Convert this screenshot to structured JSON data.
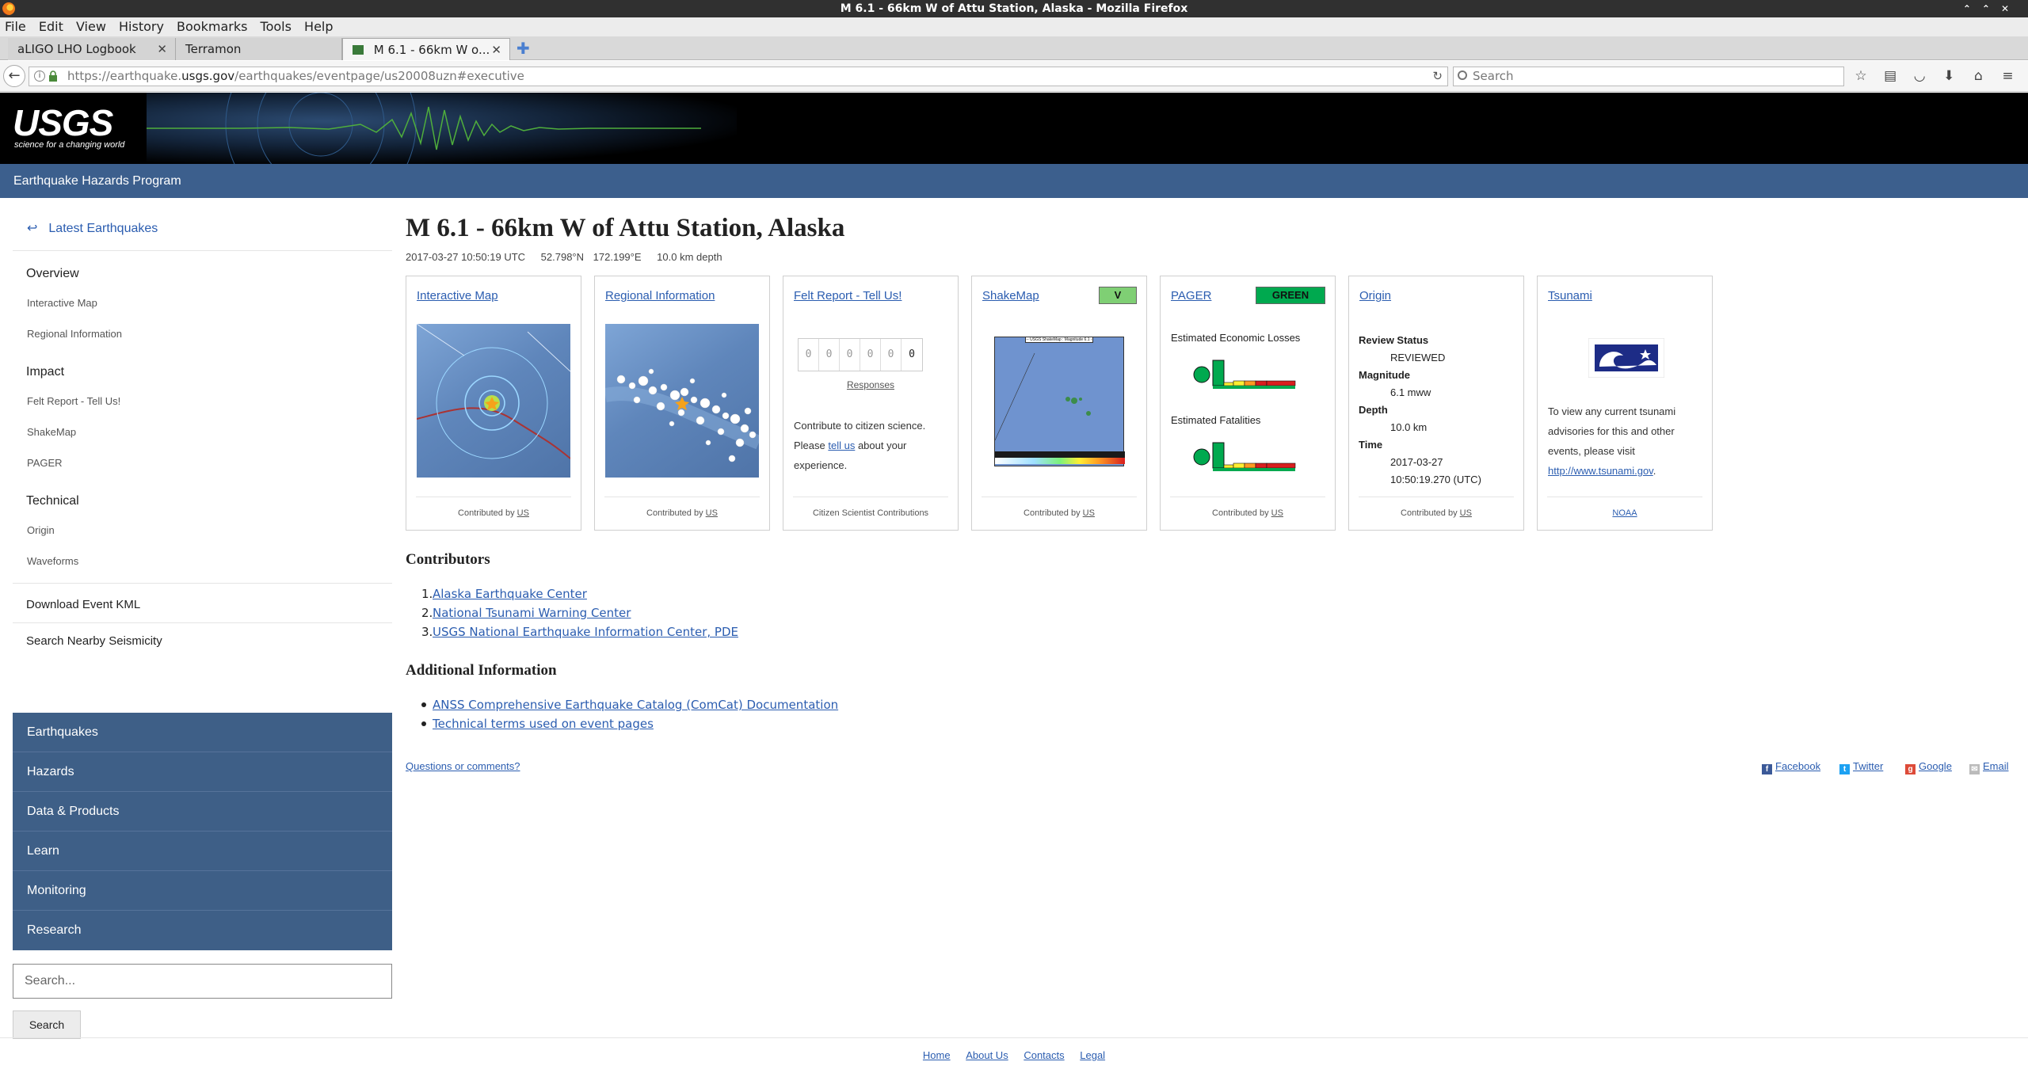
{
  "window": {
    "title": "M 6.1 - 66km W of Attu Station, Alaska - Mozilla Firefox"
  },
  "menu": [
    "File",
    "Edit",
    "View",
    "History",
    "Bookmarks",
    "Tools",
    "Help"
  ],
  "tabs": [
    {
      "label": "aLIGO LHO Logbook"
    },
    {
      "label": "Terramon"
    },
    {
      "label": "M 6.1 - 66km W o..."
    }
  ],
  "nav": {
    "url_prefix": "https://earthquake.",
    "url_domain": "usgs.gov",
    "url_path": "/earthquakes/eventpage/us20008uzn#executive",
    "search_placeholder": "Search"
  },
  "header": {
    "logo_text": "USGS",
    "logo_tagline": "science for a changing world",
    "program": "Earthquake Hazards Program"
  },
  "sidebar": {
    "back": "Latest Earthquakes",
    "sections": [
      {
        "heading": "Overview",
        "items": [
          "Interactive Map",
          "Regional Information"
        ]
      },
      {
        "heading": "Impact",
        "items": [
          "Felt Report - Tell Us!",
          "ShakeMap",
          "PAGER"
        ]
      },
      {
        "heading": "Technical",
        "items": [
          "Origin",
          "Waveforms"
        ]
      }
    ],
    "links": [
      "Download Event KML",
      "Search Nearby Seismicity"
    ],
    "nav": [
      "Earthquakes",
      "Hazards",
      "Data & Products",
      "Learn",
      "Monitoring",
      "Research"
    ],
    "search_placeholder": "Search...",
    "search_button": "Search"
  },
  "event": {
    "title": "M 6.1 - 66km W of Attu Station, Alaska",
    "time": "2017-03-27 10:50:19 UTC",
    "lat": "52.798°N",
    "lon": "172.199°E",
    "depth": "10.0 km depth"
  },
  "cards": {
    "interactive_map": {
      "title": "Interactive Map",
      "foot": "Contributed by",
      "source": "US"
    },
    "regional": {
      "title": "Regional Information",
      "foot": "Contributed by",
      "source": "US"
    },
    "felt": {
      "title": "Felt Report - Tell Us!",
      "digits": [
        "0",
        "0",
        "0",
        "0",
        "0",
        "0"
      ],
      "responses": "Responses",
      "text_a": "Contribute to citizen science. Please ",
      "link": "tell us",
      "text_b": " about your experience.",
      "foot": "Citizen Scientist Contributions"
    },
    "shakemap": {
      "title": "ShakeMap",
      "badge": "V",
      "foot": "Contributed by",
      "source": "US",
      "map_title": "-- USGS ShakeMap : Magnitude 6.1 --"
    },
    "pager": {
      "title": "PAGER",
      "badge": "GREEN",
      "losses": "Estimated Economic Losses",
      "fatalities": "Estimated Fatalities",
      "foot": "Contributed by",
      "source": "US"
    },
    "origin": {
      "title": "Origin",
      "review_label": "Review Status",
      "review": "REVIEWED",
      "mag_label": "Magnitude",
      "mag": "6.1 mww",
      "depth_label": "Depth",
      "depth": "10.0 km",
      "time_label": "Time",
      "date": "2017-03-27",
      "time": "10:50:19.270 (UTC)",
      "foot": "Contributed by",
      "source": "US"
    },
    "tsunami": {
      "title": "Tsunami",
      "text": "To view any current tsunami advisories for this and other events, please visit ",
      "link": "http://www.tsunami.gov",
      "end": ".",
      "foot": "NOAA"
    }
  },
  "contributors": {
    "heading": "Contributors",
    "items": [
      "Alaska Earthquake Center",
      "National Tsunami Warning Center",
      "USGS National Earthquake Information Center, PDE"
    ]
  },
  "additional": {
    "heading": "Additional Information",
    "items": [
      "ANSS Comprehensive Earthquake Catalog (ComCat) Documentation",
      "Technical terms used on event pages"
    ]
  },
  "questions": "Questions or comments?",
  "share": [
    "Facebook",
    "Twitter",
    "Google",
    "Email"
  ],
  "footer": [
    "Home",
    "About Us",
    "Contacts",
    "Legal"
  ],
  "colors": {
    "header_blue": "#3c5f8d",
    "nav_blue": "#3e5f87",
    "link": "#2b5db0",
    "pager_green": "#00a94f",
    "shakemap_v": "#7fcf74"
  }
}
